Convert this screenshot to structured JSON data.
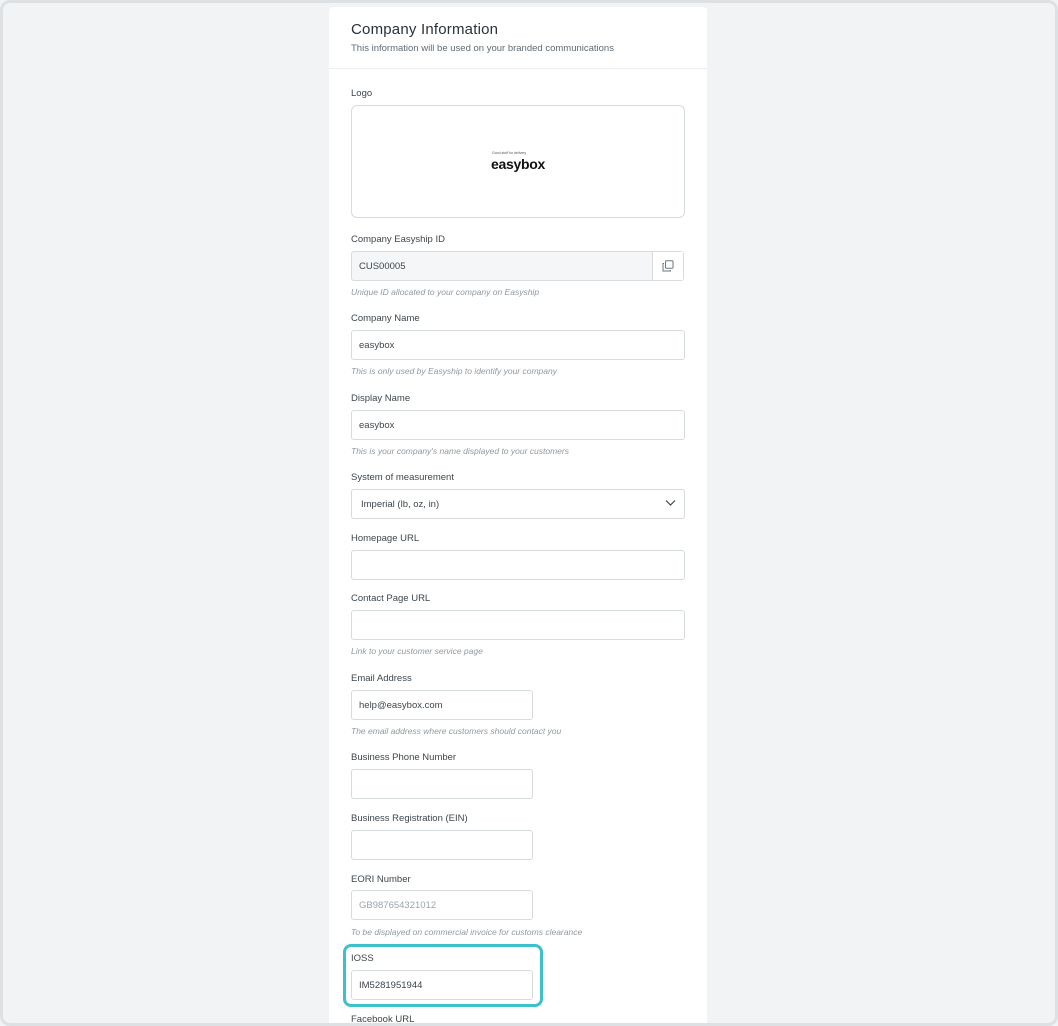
{
  "header": {
    "title": "Company Information",
    "subtitle": "This information will be used on your branded communications"
  },
  "logo": {
    "label": "Logo",
    "brand_tagline": "Good stuff for delivery",
    "brand_name": "easybox"
  },
  "easyship_id": {
    "label": "Company Easyship ID",
    "value": "CUS00005",
    "hint": "Unique ID allocated to your company on Easyship",
    "copy_icon": "copy-icon"
  },
  "company_name": {
    "label": "Company Name",
    "value": "easybox",
    "hint": "This is only used by Easyship to identify your company"
  },
  "display_name": {
    "label": "Display Name",
    "value": "easybox",
    "hint": "This is your company's name displayed to your customers"
  },
  "measurement": {
    "label": "System of measurement",
    "value": "Imperial (lb, oz, in)",
    "icon": "chevron-down-icon"
  },
  "homepage_url": {
    "label": "Homepage URL",
    "value": ""
  },
  "contact_url": {
    "label": "Contact Page URL",
    "value": "",
    "hint": "Link to your customer service page"
  },
  "email": {
    "label": "Email Address",
    "value": "help@easybox.com",
    "hint": "The email address where customers should contact you"
  },
  "phone": {
    "label": "Business Phone Number",
    "value": ""
  },
  "registration": {
    "label": "Business Registration (EIN)",
    "value": ""
  },
  "eori": {
    "label": "EORI Number",
    "placeholder": "GB987654321012",
    "hint": "To be displayed on commercial invoice for customs clearance"
  },
  "ioss": {
    "label": "IOSS",
    "value": "IM5281951944"
  },
  "facebook": {
    "label": "Facebook URL"
  },
  "colors": {
    "highlight": "#3cc1cc",
    "background": "#f1f3f5"
  }
}
